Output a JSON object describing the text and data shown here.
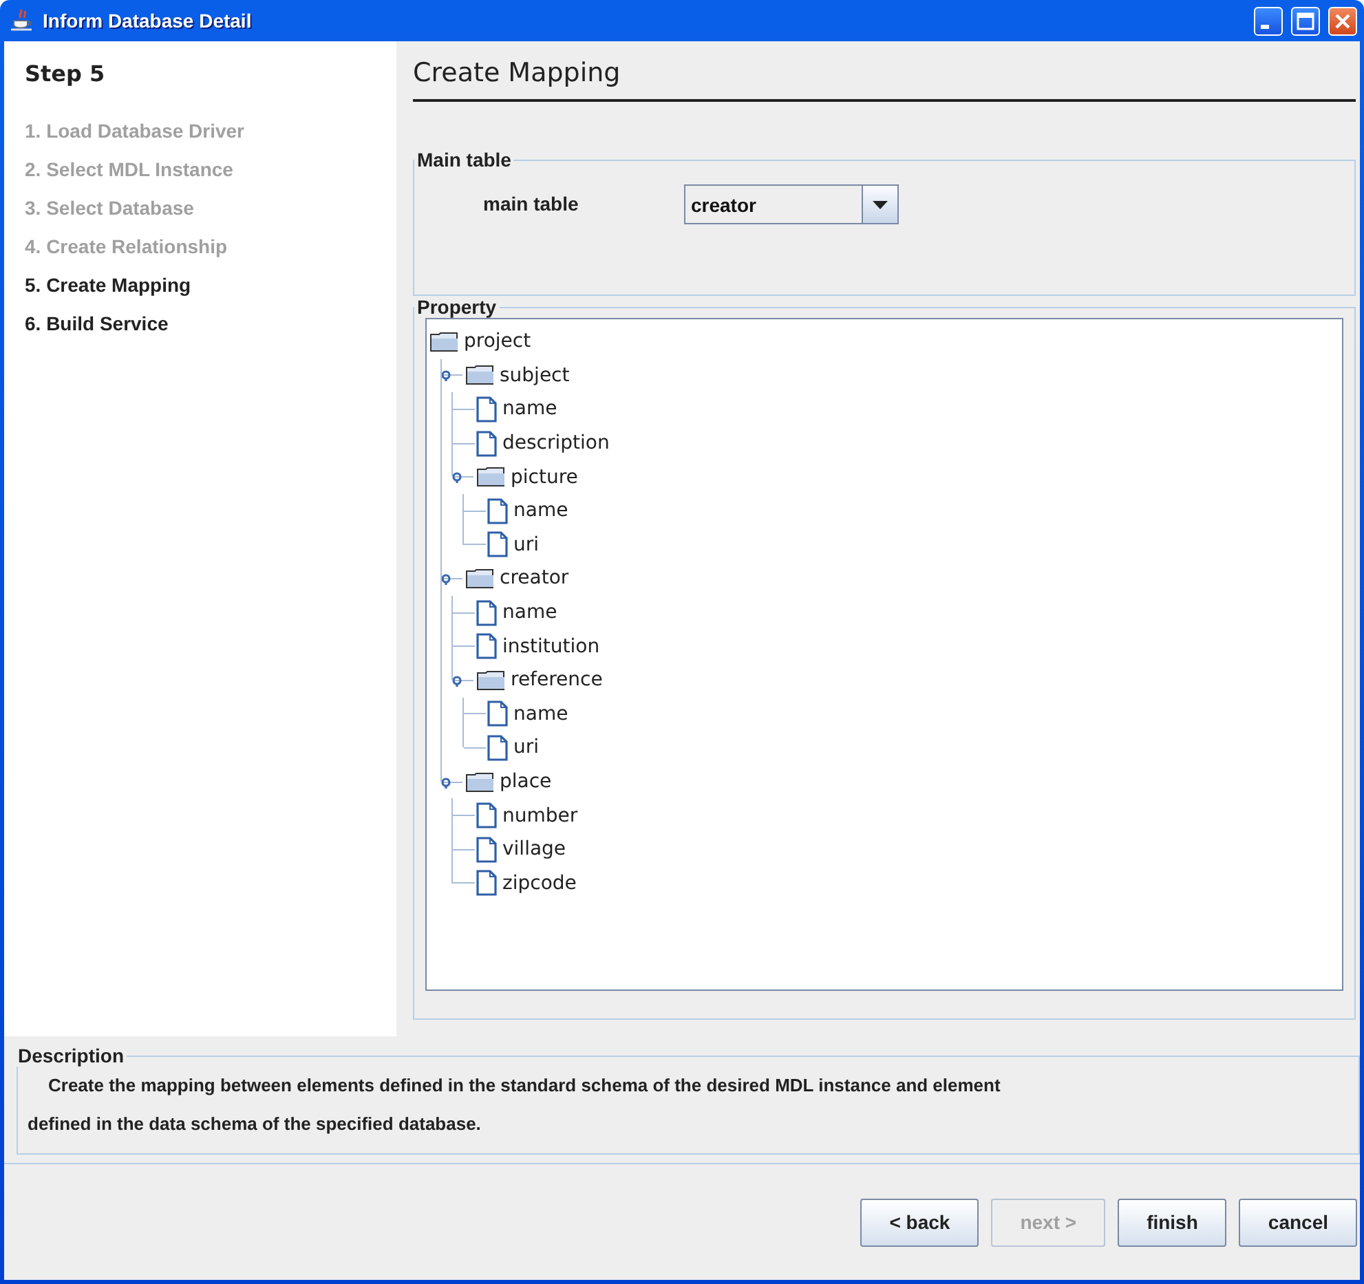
{
  "window": {
    "title": "Inform Database Detail"
  },
  "sidebar": {
    "title": "Step 5",
    "steps": [
      {
        "label": "1. Load Database Driver",
        "disabled": true
      },
      {
        "label": "2. Select MDL Instance",
        "disabled": true
      },
      {
        "label": "3. Select Database",
        "disabled": true
      },
      {
        "label": "4. Create Relationship",
        "disabled": true
      },
      {
        "label": "5. Create Mapping",
        "disabled": false
      },
      {
        "label": "6. Build Service",
        "disabled": false
      }
    ]
  },
  "page_title": "Create Mapping",
  "main_table": {
    "section": "Main table",
    "label": "main table",
    "value": "creator"
  },
  "property": {
    "section": "Property",
    "tree": [
      {
        "label": "project",
        "kind": "folder",
        "children": [
          {
            "label": "subject",
            "kind": "folder",
            "expanded": true,
            "children": [
              {
                "label": "name",
                "kind": "leaf"
              },
              {
                "label": "description",
                "kind": "leaf"
              },
              {
                "label": "picture",
                "kind": "folder",
                "expanded": true,
                "children": [
                  {
                    "label": "name",
                    "kind": "leaf"
                  },
                  {
                    "label": "uri",
                    "kind": "leaf"
                  }
                ]
              }
            ]
          },
          {
            "label": "creator",
            "kind": "folder",
            "expanded": true,
            "children": [
              {
                "label": "name",
                "kind": "leaf"
              },
              {
                "label": "institution",
                "kind": "leaf"
              },
              {
                "label": "reference",
                "kind": "folder",
                "expanded": true,
                "children": [
                  {
                    "label": "name",
                    "kind": "leaf"
                  },
                  {
                    "label": "uri",
                    "kind": "leaf"
                  }
                ]
              }
            ]
          },
          {
            "label": "place",
            "kind": "folder",
            "expanded": true,
            "children": [
              {
                "label": "number",
                "kind": "leaf"
              },
              {
                "label": "village",
                "kind": "leaf"
              },
              {
                "label": "zipcode",
                "kind": "leaf"
              }
            ]
          }
        ]
      }
    ]
  },
  "description": {
    "section": "Description",
    "lines": [
      "Create the mapping between elements defined in the standard schema of the desired MDL instance and element",
      "defined in the data schema of the specified database."
    ]
  },
  "buttons": [
    {
      "label": "< back",
      "disabled": false
    },
    {
      "label": "next >",
      "disabled": true
    },
    {
      "label": "finish",
      "disabled": false
    },
    {
      "label": "cancel",
      "disabled": false
    }
  ]
}
